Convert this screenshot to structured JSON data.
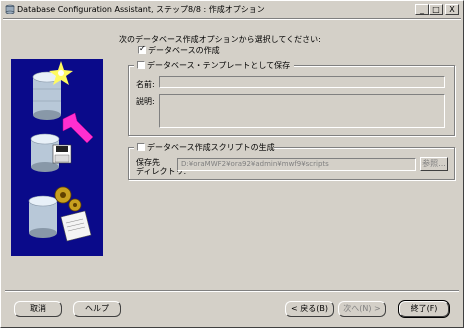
{
  "window": {
    "title": "Database Configuration Assistant, ステップ8/8 : 作成オプション",
    "minimize_label": "_",
    "maximize_label": "□",
    "close_label": "X"
  },
  "prompt": "次のデータベース作成オプションから選択してください:",
  "options": {
    "create_db": {
      "label": "データベースの作成",
      "checked": true
    },
    "save_template": {
      "label": "データベース・テンプレートとして保存",
      "checked": false
    },
    "gen_scripts": {
      "label": "データベース作成スクリプトの生成",
      "checked": false
    }
  },
  "template": {
    "name_label": "名前:",
    "name_value": "",
    "desc_label": "説明:",
    "desc_value": ""
  },
  "scripts": {
    "dir_label_1": "保存先",
    "dir_label_2": "ディレクトリ:",
    "dir_value": "D:¥oraMWF2¥ora92¥admin¥mwf9¥scripts",
    "browse_label": "参照..."
  },
  "buttons": {
    "cancel": "取消",
    "help": "ヘルプ",
    "back": "< 戻る(B)",
    "next": "次へ(N) >",
    "finish": "終了(F)"
  },
  "colors": {
    "panel_bg": "#0a0a8a",
    "window_bg": "#d4d0c8"
  },
  "icons": [
    "database-star-icon",
    "pointer-arrow-icon",
    "database-disk-icon",
    "database-gears-icon",
    "script-document-icon"
  ]
}
